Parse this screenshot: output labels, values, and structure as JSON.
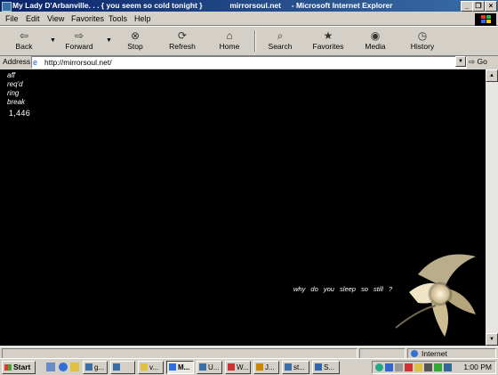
{
  "window": {
    "title": "My Lady D'Arbanville. . . { you seem so cold tonight }",
    "domain_title": "mirrorsoul.net",
    "app_title": "- Microsoft Internet Explorer"
  },
  "menu": [
    "File",
    "Edit",
    "View",
    "Favorites",
    "Tools",
    "Help"
  ],
  "toolbar": {
    "back": "Back",
    "forward": "Forward",
    "stop": "Stop",
    "refresh": "Refresh",
    "home": "Home",
    "search": "Search",
    "favorites": "Favorites",
    "media": "Media",
    "history": "History"
  },
  "address": {
    "label": "Address",
    "url": "http://mirrorsoul.net/",
    "go": "Go"
  },
  "page": {
    "links": [
      "aff",
      "req'd",
      "ring",
      "break"
    ],
    "counter": "1,446",
    "tagline": "why do you sleep so still ?"
  },
  "status": {
    "zone": "Internet"
  },
  "taskbar": {
    "start": "Start",
    "tasks": [
      "g...",
      "",
      "v...",
      "M...",
      "U...",
      "W...",
      "J...",
      "st...",
      "S..."
    ],
    "clock": "1:00 PM"
  }
}
